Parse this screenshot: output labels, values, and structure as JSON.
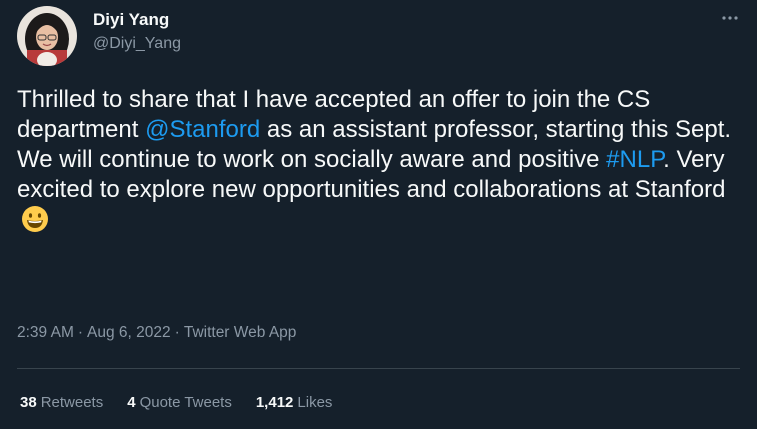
{
  "author": {
    "display_name": "Diyi Yang",
    "handle": "@Diyi_Yang"
  },
  "more_icon": "more-horizontal-icon",
  "tweet": {
    "text_1": "Thrilled to share that I have accepted an offer to join the CS department ",
    "mention": "@Stanford",
    "text_2": " as an assistant professor, starting this Sept. We will continue to work on socially aware and positive ",
    "hashtag": "#NLP",
    "text_3": ". Very excited to explore new opportunities and collaborations at Stanford",
    "emoji": "grinning-face-icon"
  },
  "meta": {
    "time": "2:39 AM",
    "date": "Aug 6, 2022",
    "source": "Twitter Web App",
    "separator": "·"
  },
  "stats": {
    "retweets_count": "38",
    "retweets_label": "Retweets",
    "quote_tweets_count": "4",
    "quote_tweets_label": "Quote Tweets",
    "likes_count": "1,412",
    "likes_label": "Likes"
  },
  "colors": {
    "background": "#15202b",
    "text": "#f7f9f9",
    "secondary": "#8b98a5",
    "link": "#1d9bf0",
    "divider": "#38444d"
  }
}
